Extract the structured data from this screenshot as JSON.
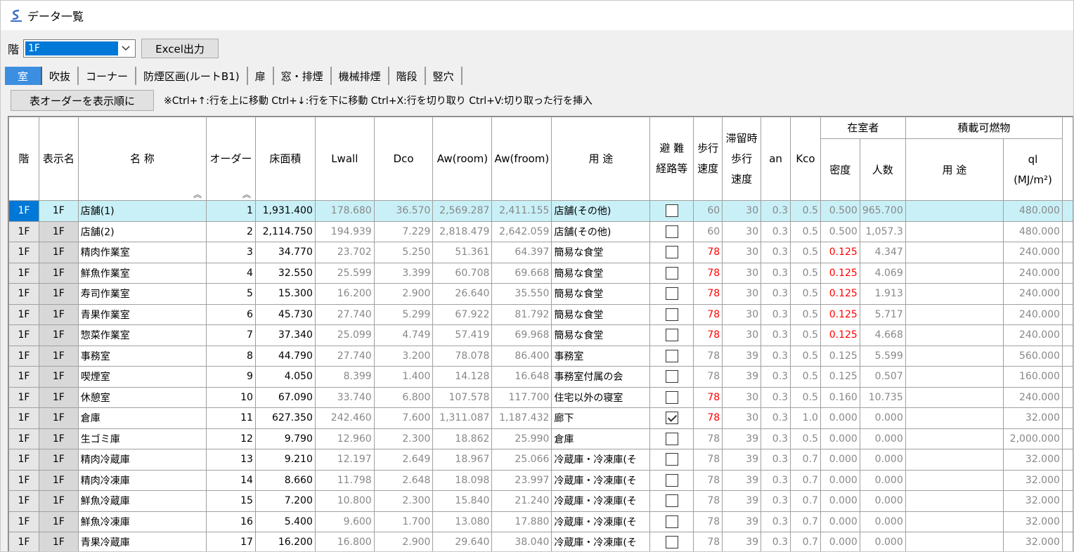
{
  "window": {
    "title": "データ一覧",
    "icon": "app-logo-icon"
  },
  "floor": {
    "label": "階",
    "selected": "1F",
    "dropdown_icon": "chevron-down-icon"
  },
  "excel_button": "Excel出力",
  "tabs": [
    {
      "label": "室",
      "active": true
    },
    {
      "label": "吹抜",
      "active": false
    },
    {
      "label": "コーナー",
      "active": false
    },
    {
      "label": "防煙区画(ルートB1)",
      "active": false
    },
    {
      "label": "扉",
      "active": false
    },
    {
      "label": "窓・排煙",
      "active": false
    },
    {
      "label": "機械排煙",
      "active": false
    },
    {
      "label": "階段",
      "active": false
    },
    {
      "label": "竪穴",
      "active": false
    }
  ],
  "toolbar": {
    "order_button": "表オーダーを表示順に",
    "hint": "※Ctrl+↑:行を上に移動 Ctrl+↓:行を下に移動 Ctrl+X:行を切り取り Ctrl+V:切り取った行を挿入"
  },
  "headers": {
    "floor": "階",
    "display_name": "表示名",
    "name": "名 称",
    "order": "オーダー",
    "floor_area": "床面積",
    "lwall": "Lwall",
    "dco": "Dco",
    "aw_room": "Aw(room)",
    "aw_froom": "Aw(froom)",
    "usage": "用 途",
    "evac_1": "避 難",
    "evac_2": "経路等",
    "walk_1": "歩行",
    "walk_2": "速度",
    "stay_1": "滞留時",
    "stay_2": "歩行",
    "stay_3": "速度",
    "an": "an",
    "kco": "Kco",
    "occupant_group": "在室者",
    "density": "密度",
    "people": "人数",
    "fuel_group": "積載可燃物",
    "fuel_usage": "用 途",
    "ql_1": "ql",
    "ql_2": "(MJ/m²)",
    "sort_icon": "sort-ascending-icon"
  },
  "rows": [
    {
      "floor": "1F",
      "disp": "1F",
      "name": "店舗(1)",
      "order": "1",
      "area": "1,931.400",
      "lwall": "178.680",
      "dco": "36.570",
      "aw_room": "2,569.287",
      "aw_froom": "2,411.155",
      "usage": "店舗(その他)",
      "evac": false,
      "walk": "60",
      "walk_red": false,
      "stay": "30",
      "an": "0.3",
      "kco": "0.5",
      "density": "0.500",
      "density_red": false,
      "people": "965.700",
      "fuel_usage": "",
      "ql": "480.000",
      "selected": true
    },
    {
      "floor": "1F",
      "disp": "1F",
      "name": "店舗(2)",
      "order": "2",
      "area": "2,114.750",
      "lwall": "194.939",
      "dco": "7.229",
      "aw_room": "2,818.479",
      "aw_froom": "2,642.059",
      "usage": "店舗(その他)",
      "evac": false,
      "walk": "60",
      "walk_red": false,
      "stay": "30",
      "an": "0.3",
      "kco": "0.5",
      "density": "0.500",
      "density_red": false,
      "people": "1,057.3",
      "fuel_usage": "",
      "ql": "480.000"
    },
    {
      "floor": "1F",
      "disp": "1F",
      "name": "精肉作業室",
      "order": "3",
      "area": "34.770",
      "lwall": "23.702",
      "dco": "5.250",
      "aw_room": "51.361",
      "aw_froom": "64.397",
      "usage": "簡易な食堂",
      "evac": false,
      "walk": "78",
      "walk_red": true,
      "stay": "30",
      "an": "0.3",
      "kco": "0.5",
      "density": "0.125",
      "density_red": true,
      "people": "4.347",
      "fuel_usage": "",
      "ql": "240.000"
    },
    {
      "floor": "1F",
      "disp": "1F",
      "name": "鮮魚作業室",
      "order": "4",
      "area": "32.550",
      "lwall": "25.599",
      "dco": "3.399",
      "aw_room": "60.708",
      "aw_froom": "69.668",
      "usage": "簡易な食堂",
      "evac": false,
      "walk": "78",
      "walk_red": true,
      "stay": "30",
      "an": "0.3",
      "kco": "0.5",
      "density": "0.125",
      "density_red": true,
      "people": "4.069",
      "fuel_usage": "",
      "ql": "240.000"
    },
    {
      "floor": "1F",
      "disp": "1F",
      "name": "寿司作業室",
      "order": "5",
      "area": "15.300",
      "lwall": "16.200",
      "dco": "2.900",
      "aw_room": "26.640",
      "aw_froom": "35.550",
      "usage": "簡易な食堂",
      "evac": false,
      "walk": "78",
      "walk_red": true,
      "stay": "30",
      "an": "0.3",
      "kco": "0.5",
      "density": "0.125",
      "density_red": true,
      "people": "1.913",
      "fuel_usage": "",
      "ql": "240.000"
    },
    {
      "floor": "1F",
      "disp": "1F",
      "name": "青果作業室",
      "order": "6",
      "area": "45.730",
      "lwall": "27.740",
      "dco": "5.299",
      "aw_room": "67.922",
      "aw_froom": "81.792",
      "usage": "簡易な食堂",
      "evac": false,
      "walk": "78",
      "walk_red": true,
      "stay": "30",
      "an": "0.3",
      "kco": "0.5",
      "density": "0.125",
      "density_red": true,
      "people": "5.717",
      "fuel_usage": "",
      "ql": "240.000"
    },
    {
      "floor": "1F",
      "disp": "1F",
      "name": "惣菜作業室",
      "order": "7",
      "area": "37.340",
      "lwall": "25.099",
      "dco": "4.749",
      "aw_room": "57.419",
      "aw_froom": "69.968",
      "usage": "簡易な食堂",
      "evac": false,
      "walk": "78",
      "walk_red": true,
      "stay": "30",
      "an": "0.3",
      "kco": "0.5",
      "density": "0.125",
      "density_red": true,
      "people": "4.668",
      "fuel_usage": "",
      "ql": "240.000"
    },
    {
      "floor": "1F",
      "disp": "1F",
      "name": "事務室",
      "order": "8",
      "area": "44.790",
      "lwall": "27.740",
      "dco": "3.200",
      "aw_room": "78.078",
      "aw_froom": "86.400",
      "usage": "事務室",
      "evac": false,
      "walk": "78",
      "walk_red": false,
      "stay": "39",
      "an": "0.3",
      "kco": "0.5",
      "density": "0.125",
      "density_red": false,
      "people": "5.599",
      "fuel_usage": "",
      "ql": "560.000"
    },
    {
      "floor": "1F",
      "disp": "1F",
      "name": "喫煙室",
      "order": "9",
      "area": "4.050",
      "lwall": "8.399",
      "dco": "1.400",
      "aw_room": "14.128",
      "aw_froom": "16.648",
      "usage": "事務室付属の会",
      "evac": false,
      "walk": "78",
      "walk_red": false,
      "stay": "39",
      "an": "0.3",
      "kco": "0.5",
      "density": "0.125",
      "density_red": false,
      "people": "0.507",
      "fuel_usage": "",
      "ql": "160.000"
    },
    {
      "floor": "1F",
      "disp": "1F",
      "name": "休憩室",
      "order": "10",
      "area": "67.090",
      "lwall": "33.740",
      "dco": "6.800",
      "aw_room": "107.578",
      "aw_froom": "117.700",
      "usage": "住宅以外の寝室",
      "evac": false,
      "walk": "78",
      "walk_red": true,
      "stay": "30",
      "an": "0.3",
      "kco": "0.5",
      "density": "0.160",
      "density_red": false,
      "people": "10.735",
      "fuel_usage": "",
      "ql": "240.000"
    },
    {
      "floor": "1F",
      "disp": "1F",
      "name": "倉庫",
      "order": "11",
      "area": "627.350",
      "lwall": "242.460",
      "dco": "7.600",
      "aw_room": "1,311.087",
      "aw_froom": "1,187.432",
      "usage": "廊下",
      "evac": true,
      "walk": "78",
      "walk_red": true,
      "stay": "30",
      "an": "0.3",
      "kco": "1.0",
      "density": "0.000",
      "density_red": false,
      "people": "0.000",
      "fuel_usage": "",
      "ql": "32.000"
    },
    {
      "floor": "1F",
      "disp": "1F",
      "name": "生ゴミ庫",
      "order": "12",
      "area": "9.790",
      "lwall": "12.960",
      "dco": "2.300",
      "aw_room": "18.862",
      "aw_froom": "25.990",
      "usage": "倉庫",
      "evac": false,
      "walk": "78",
      "walk_red": false,
      "stay": "39",
      "an": "0.3",
      "kco": "0.5",
      "density": "0.000",
      "density_red": false,
      "people": "0.000",
      "fuel_usage": "",
      "ql": "2,000.000"
    },
    {
      "floor": "1F",
      "disp": "1F",
      "name": "精肉冷蔵庫",
      "order": "13",
      "area": "9.210",
      "lwall": "12.197",
      "dco": "2.649",
      "aw_room": "18.967",
      "aw_froom": "25.066",
      "usage": "冷蔵庫・冷凍庫(そ",
      "evac": false,
      "walk": "78",
      "walk_red": false,
      "stay": "39",
      "an": "0.3",
      "kco": "0.7",
      "density": "0.000",
      "density_red": false,
      "people": "0.000",
      "fuel_usage": "",
      "ql": "32.000"
    },
    {
      "floor": "1F",
      "disp": "1F",
      "name": "精肉冷凍庫",
      "order": "14",
      "area": "8.660",
      "lwall": "11.798",
      "dco": "2.648",
      "aw_room": "18.098",
      "aw_froom": "23.997",
      "usage": "冷蔵庫・冷凍庫(そ",
      "evac": false,
      "walk": "78",
      "walk_red": false,
      "stay": "39",
      "an": "0.3",
      "kco": "0.7",
      "density": "0.000",
      "density_red": false,
      "people": "0.000",
      "fuel_usage": "",
      "ql": "32.000"
    },
    {
      "floor": "1F",
      "disp": "1F",
      "name": "鮮魚冷蔵庫",
      "order": "15",
      "area": "7.200",
      "lwall": "10.800",
      "dco": "2.300",
      "aw_room": "15.840",
      "aw_froom": "21.240",
      "usage": "冷蔵庫・冷凍庫(そ",
      "evac": false,
      "walk": "78",
      "walk_red": false,
      "stay": "39",
      "an": "0.3",
      "kco": "0.7",
      "density": "0.000",
      "density_red": false,
      "people": "0.000",
      "fuel_usage": "",
      "ql": "32.000"
    },
    {
      "floor": "1F",
      "disp": "1F",
      "name": "鮮魚冷凍庫",
      "order": "16",
      "area": "5.400",
      "lwall": "9.600",
      "dco": "1.700",
      "aw_room": "13.080",
      "aw_froom": "17.880",
      "usage": "冷蔵庫・冷凍庫(そ",
      "evac": false,
      "walk": "78",
      "walk_red": false,
      "stay": "39",
      "an": "0.3",
      "kco": "0.7",
      "density": "0.000",
      "density_red": false,
      "people": "0.000",
      "fuel_usage": "",
      "ql": "32.000"
    },
    {
      "floor": "1F",
      "disp": "1F",
      "name": "青果冷蔵庫",
      "order": "17",
      "area": "16.200",
      "lwall": "16.800",
      "dco": "2.900",
      "aw_room": "29.640",
      "aw_froom": "38.040",
      "usage": "冷蔵庫・冷凍庫(そ",
      "evac": false,
      "walk": "78",
      "walk_red": false,
      "stay": "39",
      "an": "0.3",
      "kco": "0.7",
      "density": "0.000",
      "density_red": false,
      "people": "0.000",
      "fuel_usage": "",
      "ql": "32.000"
    }
  ]
}
